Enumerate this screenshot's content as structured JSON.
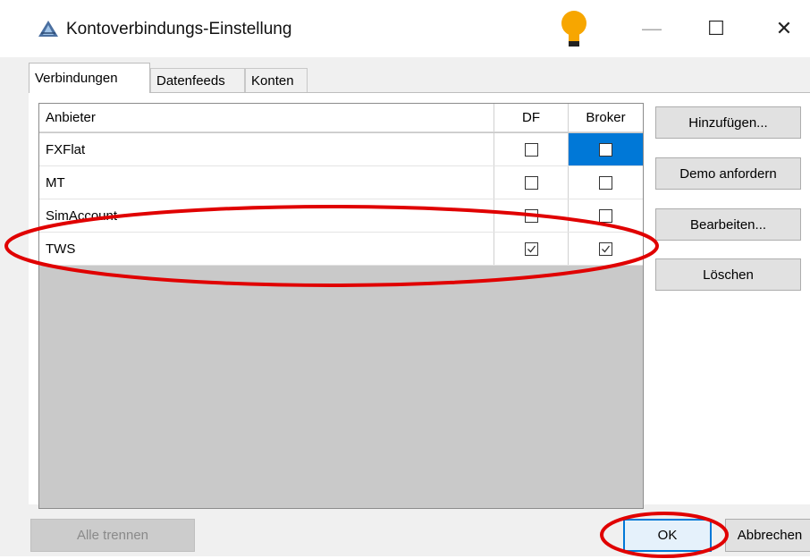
{
  "window": {
    "title": "Kontoverbindungs-Einstellung",
    "controls": {
      "minimize": "—",
      "maximize": "☐",
      "close": "✕"
    }
  },
  "tabs": [
    {
      "label": "Verbindungen",
      "active": true
    },
    {
      "label": "Datenfeeds",
      "active": false
    },
    {
      "label": "Konten",
      "active": false
    }
  ],
  "grid": {
    "columns": [
      "Anbieter",
      "DF",
      "Broker"
    ],
    "rows": [
      {
        "name": "FXFlat",
        "df": false,
        "broker": false,
        "broker_selected": true
      },
      {
        "name": "MT",
        "df": false,
        "broker": false
      },
      {
        "name": "SimAccount",
        "df": false,
        "broker": false
      },
      {
        "name": "TWS",
        "df": true,
        "broker": true
      }
    ]
  },
  "side_buttons": {
    "add": "Hinzufügen...",
    "demo": "Demo anfordern",
    "edit": "Bearbeiten...",
    "delete": "Löschen"
  },
  "bottom_buttons": {
    "disconnect_all": "Alle trennen",
    "ok": "OK",
    "cancel": "Abbrechen"
  },
  "colors": {
    "accent": "#0078d7",
    "annotation": "#e00000"
  }
}
